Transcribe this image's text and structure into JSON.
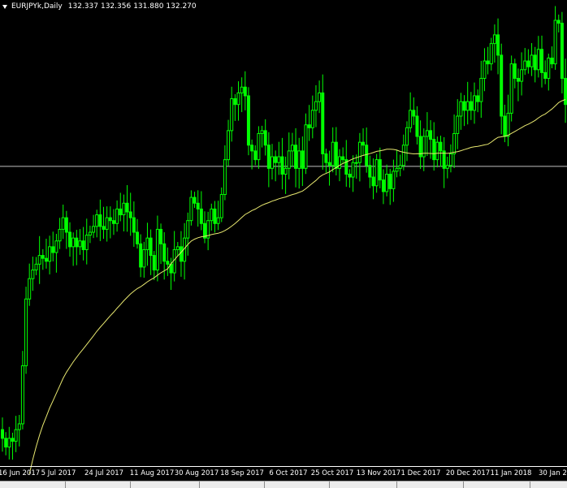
{
  "header": {
    "symbol": "EURJPYk,Daily",
    "open": "132.337",
    "high": "132.356",
    "low": "131.880",
    "close": "132.270"
  },
  "x_axis": {
    "labels": [
      "16 Jun 2017",
      "5 Jul 2017",
      "24 Jul 2017",
      "11 Aug 2017",
      "30 Aug 2017",
      "18 Sep 2017",
      "6 Oct 2017",
      "25 Oct 2017",
      "13 Nov 2017",
      "1 Dec 2017",
      "20 Dec 2017",
      "11 Jan 2018",
      "30 Jan 20"
    ]
  },
  "colors": {
    "background": "#000000",
    "candle": "#00ff00",
    "moving_average": "#e8e870",
    "bid_line": "#c0c0c0",
    "text": "#ffffff"
  },
  "chart_data": {
    "type": "candlestick",
    "symbol": "EURJPYk",
    "timeframe": "Daily",
    "x_range": [
      "16 Jun 2017",
      "30 Jan 20"
    ],
    "y_range": [
      122.0,
      138.0
    ],
    "grid": false,
    "bid_price": 132.27,
    "close_series": [
      122.9,
      122.6,
      122.9,
      122.8,
      123.2,
      123.4,
      125.4,
      127.7,
      128.4,
      128.7,
      128.9,
      129.2,
      129.1,
      129.0,
      129.5,
      129.3,
      129.7,
      130.1,
      130.5,
      130.0,
      129.5,
      129.8,
      129.5,
      129.7,
      129.4,
      129.9,
      130.0,
      130.2,
      130.6,
      130.2,
      130.1,
      130.5,
      130.4,
      130.3,
      130.8,
      130.6,
      131.0,
      130.7,
      130.5,
      130.0,
      129.6,
      128.8,
      129.4,
      129.8,
      129.2,
      128.7,
      130.1,
      129.6,
      129.0,
      128.9,
      128.6,
      129.4,
      129.5,
      129.0,
      129.8,
      130.4,
      131.2,
      131.0,
      130.8,
      130.3,
      129.8,
      130.4,
      130.8,
      130.3,
      130.5,
      131.3,
      132.5,
      133.5,
      134.6,
      134.4,
      134.8,
      135.0,
      134.7,
      133.0,
      132.8,
      132.5,
      133.4,
      133.5,
      133.0,
      132.2,
      132.6,
      132.4,
      132.6,
      132.0,
      132.2,
      132.8,
      133.0,
      132.2,
      132.8,
      132.2,
      133.7,
      133.6,
      134.2,
      134.5,
      134.8,
      132.7,
      132.4,
      132.3,
      133.1,
      132.2,
      132.6,
      132.5,
      132.0,
      131.9,
      132.4,
      132.4,
      133.1,
      133.0,
      132.3,
      131.9,
      131.6,
      132.5,
      131.8,
      131.4,
      132.0,
      131.5,
      132.1,
      132.2,
      132.3,
      133.0,
      133.6,
      134.2,
      134.0,
      133.3,
      132.6,
      133.3,
      133.5,
      133.2,
      132.5,
      133.1,
      132.8,
      132.2,
      132.3,
      132.7,
      133.4,
      134.0,
      134.5,
      134.2,
      134.5,
      134.2,
      134.7,
      134.5,
      135.3,
      135.9,
      135.8,
      136.5,
      136.8,
      136.1,
      134.0,
      133.3,
      134.1,
      135.8,
      135.3,
      135.2,
      135.6,
      135.9,
      135.7,
      136.1,
      135.6,
      136.3,
      135.5,
      135.3,
      136.0,
      135.8,
      137.3,
      137.2,
      135.3,
      134.4
    ]
  }
}
